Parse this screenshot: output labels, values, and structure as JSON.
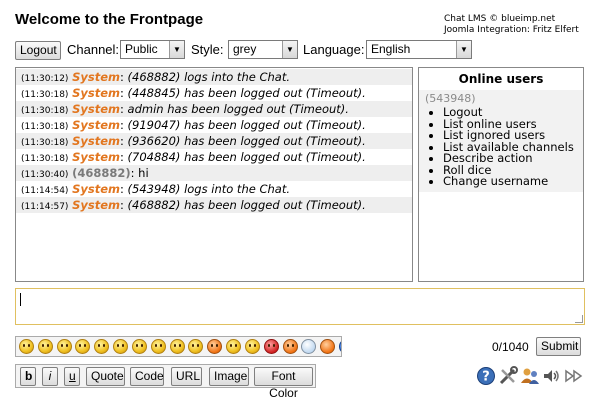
{
  "header": {
    "title": "Welcome to the Frontpage",
    "credit_line1": "Chat LMS © blueimp.net",
    "credit_line2": "Joomla Integration: Fritz Elfert"
  },
  "toolbar": {
    "logout_label": "Logout",
    "channel_label": "Channel:",
    "channel_value": "Public",
    "style_label": "Style:",
    "style_value": "grey",
    "language_label": "Language:",
    "language_value": "English"
  },
  "messages": [
    {
      "time": "(11:30:12)",
      "name": "System",
      "text": "(468882) logs into the Chat."
    },
    {
      "time": "(11:30:18)",
      "name": "System",
      "text": "(448845) has been logged out (Timeout)."
    },
    {
      "time": "(11:30:18)",
      "name": "System",
      "text": "admin has been logged out (Timeout)."
    },
    {
      "time": "(11:30:18)",
      "name": "System",
      "text": "(919047) has been logged out (Timeout)."
    },
    {
      "time": "(11:30:18)",
      "name": "System",
      "text": "(936620) has been logged out (Timeout)."
    },
    {
      "time": "(11:30:18)",
      "name": "System",
      "text": "(704884) has been logged out (Timeout)."
    },
    {
      "time": "(11:30:40)",
      "name": "(468882)",
      "text": "hi"
    },
    {
      "time": "(11:14:54)",
      "name": "System",
      "text": "(543948) logs into the Chat."
    },
    {
      "time": "(11:14:57)",
      "name": "System",
      "text": "(468882) has been logged out (Timeout)."
    }
  ],
  "online": {
    "title": "Online users",
    "user": "(543948)",
    "menu": [
      "Logout",
      "List online users",
      "List ignored users",
      "List available channels",
      "Describe action",
      "Roll dice",
      "Change username"
    ]
  },
  "input": {
    "value": ""
  },
  "emoticons": [
    "smile",
    "wink",
    "tongue",
    "laugh",
    "grin",
    "cry",
    "sad",
    "cool",
    "surprised",
    "huh",
    "blush",
    "oops",
    "tongue-out",
    "angry",
    "evil",
    "idea",
    "info",
    "question",
    "no-entry",
    "warning",
    "heart"
  ],
  "counter": "0/1040",
  "submit_label": "Submit",
  "format": {
    "bold": "b",
    "italic": "i",
    "underline": "u",
    "quote": "Quote",
    "code": "Code",
    "url": "URL",
    "image": "Image",
    "font_color": "Font Color"
  },
  "bottom_icons": [
    "help-icon",
    "settings-icon",
    "online-users-icon",
    "sound-icon",
    "autoscroll-icon"
  ],
  "colors": {
    "system_name": "#e2761f",
    "user_name": "#7a7a7a",
    "input_border": "#e0c060"
  }
}
